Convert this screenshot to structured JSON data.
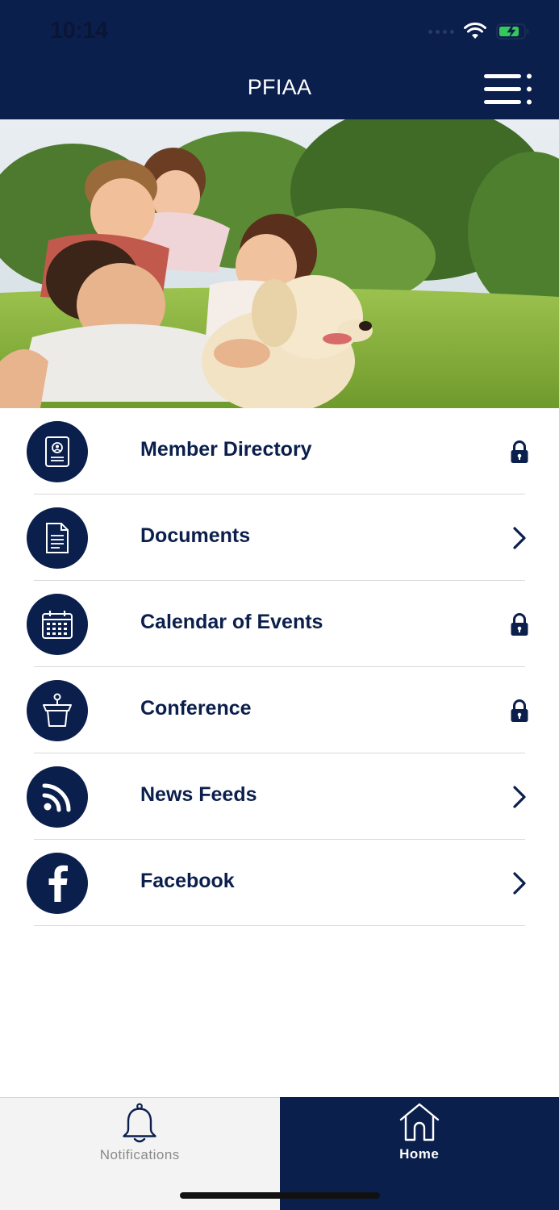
{
  "status_bar": {
    "time": "10:14",
    "icons": [
      "signal-icon",
      "wifi-icon",
      "battery-charging-icon"
    ]
  },
  "header": {
    "title": "PFIAA",
    "menu_icon": "hamburger-menu-icon"
  },
  "hero": {
    "image": "family-with-dog-on-lawn-photo"
  },
  "menu": {
    "items": [
      {
        "label": "Member Directory",
        "icon": "member-card-icon",
        "trailing": "lock-icon"
      },
      {
        "label": "Documents",
        "icon": "document-icon",
        "trailing": "chevron-right-icon"
      },
      {
        "label": "Calendar of Events",
        "icon": "calendar-icon",
        "trailing": "lock-icon"
      },
      {
        "label": "Conference",
        "icon": "podium-icon",
        "trailing": "lock-icon"
      },
      {
        "label": "News Feeds",
        "icon": "rss-icon",
        "trailing": "chevron-right-icon"
      },
      {
        "label": "Facebook",
        "icon": "facebook-icon",
        "trailing": "chevron-right-icon"
      }
    ]
  },
  "tabbar": {
    "tabs": [
      {
        "label": "Notifications",
        "icon": "bell-icon",
        "active": false
      },
      {
        "label": "Home",
        "icon": "home-icon",
        "active": true
      }
    ]
  },
  "colors": {
    "primary": "#0b1f4d",
    "divider": "#d9d9d9",
    "tab_inactive_bg": "#f3f3f3",
    "tab_inactive_text": "#8a8a8a",
    "battery_green": "#34c759"
  }
}
